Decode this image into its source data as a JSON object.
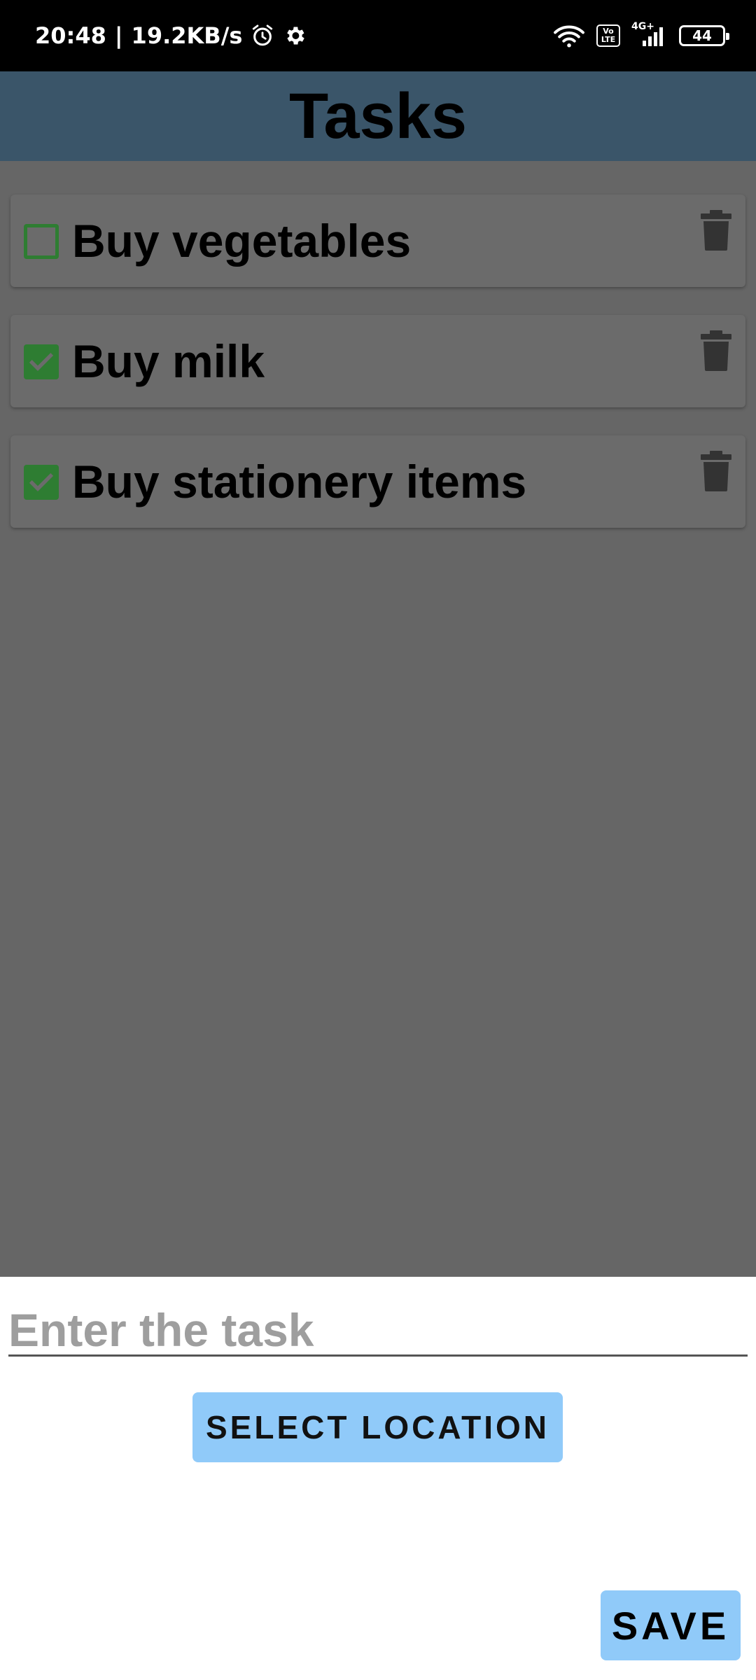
{
  "status_bar": {
    "time": "20:48",
    "separator": "|",
    "network_speed": "19.2KB/s",
    "battery_level": "44",
    "network_type": "4G+",
    "volte_label_top": "Vo",
    "volte_label_bottom": "LTE",
    "icons": [
      "alarm-icon",
      "settings-gear-icon",
      "wifi-icon",
      "volte-icon",
      "signal-icon",
      "battery-icon"
    ]
  },
  "app_bar": {
    "title": "Tasks",
    "background_color": "#3a5569"
  },
  "tasks": [
    {
      "label": "Buy vegetables",
      "completed": false
    },
    {
      "label": "Buy milk",
      "completed": true
    },
    {
      "label": "Buy stationery items",
      "completed": true
    }
  ],
  "bottom_sheet": {
    "task_input_value": "",
    "task_input_placeholder": "Enter the task",
    "select_location_label": "SELECT LOCATION",
    "save_label": "SAVE"
  },
  "colors": {
    "checkbox_green": "#2e7d32",
    "button_blue": "#90caf9",
    "scrim_gray": "#666666"
  }
}
